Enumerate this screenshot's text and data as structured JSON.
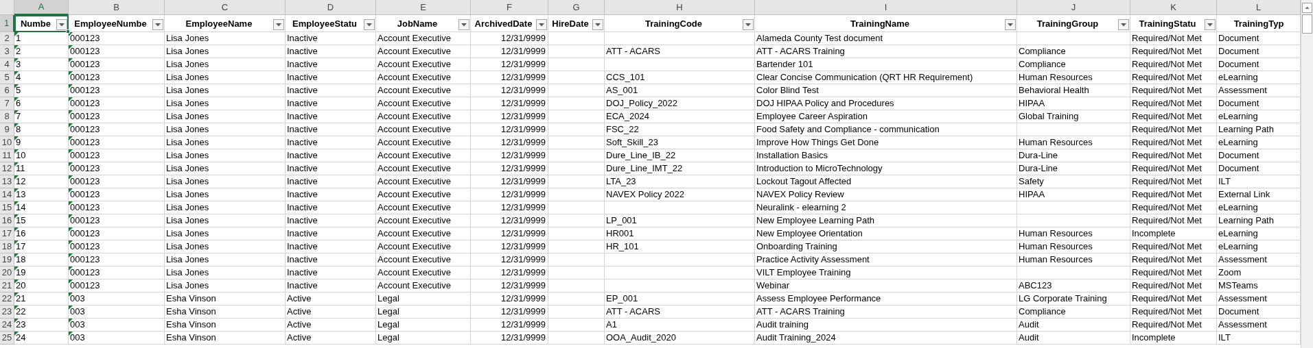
{
  "header_row_number": "1",
  "columns": [
    {
      "letter": "A",
      "header": "Numbe",
      "kind": "text",
      "selected": true,
      "filter_button": true,
      "number_as_text": true
    },
    {
      "letter": "B",
      "header": "EmployeeNumbe",
      "kind": "text",
      "selected": false,
      "filter_button": true,
      "number_as_text": true
    },
    {
      "letter": "C",
      "header": "EmployeeName",
      "kind": "text",
      "selected": false,
      "filter_button": true,
      "number_as_text": false
    },
    {
      "letter": "D",
      "header": "EmployeeStatu",
      "kind": "text",
      "selected": false,
      "filter_button": true,
      "number_as_text": false
    },
    {
      "letter": "E",
      "header": "JobName",
      "kind": "text",
      "selected": false,
      "filter_button": true,
      "number_as_text": false
    },
    {
      "letter": "F",
      "header": "ArchivedDate",
      "kind": "date",
      "selected": false,
      "filter_button": true,
      "number_as_text": false
    },
    {
      "letter": "G",
      "header": "HireDate",
      "selected": false,
      "filter_button": true,
      "number_as_text": false
    },
    {
      "letter": "H",
      "header": "TrainingCode",
      "kind": "text",
      "selected": false,
      "filter_button": true,
      "number_as_text": false
    },
    {
      "letter": "I",
      "header": "TrainingName",
      "kind": "text",
      "selected": false,
      "filter_button": true,
      "number_as_text": false
    },
    {
      "letter": "J",
      "header": "TrainingGroup",
      "kind": "text",
      "selected": false,
      "filter_button": true,
      "number_as_text": false
    },
    {
      "letter": "K",
      "header": "TrainingStatu",
      "kind": "text",
      "selected": false,
      "filter_button": true,
      "number_as_text": false
    },
    {
      "letter": "L",
      "header": "TrainingTyp",
      "kind": "text",
      "selected": false,
      "filter_button": false,
      "number_as_text": false
    }
  ],
  "rows": [
    {
      "row_number": "2",
      "cells": [
        "1",
        "000123",
        "Lisa Jones",
        "Inactive",
        "Account Executive",
        "12/31/9999",
        null,
        null,
        "Alameda County Test document",
        null,
        "Required/Not Met",
        "Document"
      ]
    },
    {
      "row_number": "3",
      "cells": [
        "2",
        "000123",
        "Lisa Jones",
        "Inactive",
        "Account Executive",
        "12/31/9999",
        null,
        "ATT - ACARS",
        "ATT - ACARS Training",
        "Compliance",
        "Required/Not Met",
        "Document"
      ]
    },
    {
      "row_number": "4",
      "cells": [
        "3",
        "000123",
        "Lisa Jones",
        "Inactive",
        "Account Executive",
        "12/31/9999",
        null,
        null,
        "Bartender 101",
        "Compliance",
        "Required/Not Met",
        "Document"
      ]
    },
    {
      "row_number": "5",
      "cells": [
        "4",
        "000123",
        "Lisa Jones",
        "Inactive",
        "Account Executive",
        "12/31/9999",
        null,
        "CCS_101",
        "Clear Concise Communication (QRT HR Requirement)",
        "Human Resources",
        "Required/Not Met",
        "eLearning"
      ]
    },
    {
      "row_number": "6",
      "cells": [
        "5",
        "000123",
        "Lisa Jones",
        "Inactive",
        "Account Executive",
        "12/31/9999",
        null,
        "AS_001",
        "Color Blind Test",
        "Behavioral Health",
        "Required/Not Met",
        "Assessment"
      ]
    },
    {
      "row_number": "7",
      "cells": [
        "6",
        "000123",
        "Lisa Jones",
        "Inactive",
        "Account Executive",
        "12/31/9999",
        null,
        "DOJ_Policy_2022",
        "DOJ HIPAA Policy and Procedures",
        "HIPAA",
        "Required/Not Met",
        "Document"
      ]
    },
    {
      "row_number": "8",
      "cells": [
        "7",
        "000123",
        "Lisa Jones",
        "Inactive",
        "Account Executive",
        "12/31/9999",
        null,
        "ECA_2024",
        "Employee Career Aspiration",
        "Global Training",
        "Required/Not Met",
        "eLearning"
      ]
    },
    {
      "row_number": "9",
      "cells": [
        "8",
        "000123",
        "Lisa Jones",
        "Inactive",
        "Account Executive",
        "12/31/9999",
        null,
        "FSC_22",
        "Food Safety and Compliance - communication",
        null,
        "Required/Not Met",
        "Learning Path"
      ]
    },
    {
      "row_number": "10",
      "cells": [
        "9",
        "000123",
        "Lisa Jones",
        "Inactive",
        "Account Executive",
        "12/31/9999",
        null,
        "Soft_Skill_23",
        "Improve How Things Get Done",
        "Human Resources",
        "Required/Not Met",
        "eLearning"
      ]
    },
    {
      "row_number": "11",
      "cells": [
        "10",
        "000123",
        "Lisa Jones",
        "Inactive",
        "Account Executive",
        "12/31/9999",
        null,
        "Dure_Line_IB_22",
        "Installation Basics",
        "Dura-Line",
        "Required/Not Met",
        "Document"
      ]
    },
    {
      "row_number": "12",
      "cells": [
        "11",
        "000123",
        "Lisa Jones",
        "Inactive",
        "Account Executive",
        "12/31/9999",
        null,
        "Dure_Line_IMT_22",
        "Introduction to MicroTechnology",
        "Dura-Line",
        "Required/Not Met",
        "Document"
      ]
    },
    {
      "row_number": "13",
      "cells": [
        "12",
        "000123",
        "Lisa Jones",
        "Inactive",
        "Account Executive",
        "12/31/9999",
        null,
        "LTA_23",
        "Lockout Tagout Affected",
        "Safety",
        "Required/Not Met",
        "ILT"
      ]
    },
    {
      "row_number": "14",
      "cells": [
        "13",
        "000123",
        "Lisa Jones",
        "Inactive",
        "Account Executive",
        "12/31/9999",
        null,
        "NAVEX Policy 2022",
        "NAVEX Policy Review",
        "HIPAA",
        "Required/Not Met",
        "External Link"
      ]
    },
    {
      "row_number": "15",
      "cells": [
        "14",
        "000123",
        "Lisa Jones",
        "Inactive",
        "Account Executive",
        "12/31/9999",
        null,
        null,
        "Neuralink - elearning 2",
        null,
        "Required/Not Met",
        "eLearning"
      ]
    },
    {
      "row_number": "16",
      "cells": [
        "15",
        "000123",
        "Lisa Jones",
        "Inactive",
        "Account Executive",
        "12/31/9999",
        null,
        "LP_001",
        "New Employee Learning Path",
        null,
        "Required/Not Met",
        "Learning Path"
      ]
    },
    {
      "row_number": "17",
      "cells": [
        "16",
        "000123",
        "Lisa Jones",
        "Inactive",
        "Account Executive",
        "12/31/9999",
        null,
        "HR001",
        "New Employee Orientation",
        "Human Resources",
        "Incomplete",
        "eLearning"
      ]
    },
    {
      "row_number": "18",
      "cells": [
        "17",
        "000123",
        "Lisa Jones",
        "Inactive",
        "Account Executive",
        "12/31/9999",
        null,
        "HR_101",
        "Onboarding Training",
        "Human Resources",
        "Required/Not Met",
        "eLearning"
      ]
    },
    {
      "row_number": "19",
      "cells": [
        "18",
        "000123",
        "Lisa Jones",
        "Inactive",
        "Account Executive",
        "12/31/9999",
        null,
        null,
        "Practice Activity Assessment",
        "Human Resources",
        "Required/Not Met",
        "Assessment"
      ]
    },
    {
      "row_number": "20",
      "cells": [
        "19",
        "000123",
        "Lisa Jones",
        "Inactive",
        "Account Executive",
        "12/31/9999",
        null,
        null,
        "VILT Employee Training",
        null,
        "Required/Not Met",
        "Zoom"
      ]
    },
    {
      "row_number": "21",
      "cells": [
        "20",
        "000123",
        "Lisa Jones",
        "Inactive",
        "Account Executive",
        "12/31/9999",
        null,
        null,
        "Webinar",
        "ABC123",
        "Required/Not Met",
        "MSTeams"
      ]
    },
    {
      "row_number": "22",
      "cells": [
        "21",
        "003",
        "Esha Vinson",
        "Active",
        "Legal",
        "12/31/9999",
        null,
        "EP_001",
        "Assess Employee Performance",
        "LG Corporate Training",
        "Required/Not Met",
        "Assessment"
      ]
    },
    {
      "row_number": "23",
      "cells": [
        "22",
        "003",
        "Esha Vinson",
        "Active",
        "Legal",
        "12/31/9999",
        null,
        "ATT - ACARS",
        "ATT - ACARS Training",
        "Compliance",
        "Required/Not Met",
        "Document"
      ]
    },
    {
      "row_number": "24",
      "cells": [
        "23",
        "003",
        "Esha Vinson",
        "Active",
        "Legal",
        "12/31/9999",
        null,
        "A1",
        "Audit training",
        "Audit",
        "Required/Not Met",
        "Assessment"
      ]
    },
    {
      "row_number": "25",
      "cells": [
        "24",
        "003",
        "Esha Vinson",
        "Active",
        "Legal",
        "12/31/9999",
        null,
        "OOA_Audit_2020",
        "Audit Training_2024",
        "Audit",
        "Incomplete",
        "ILT"
      ]
    }
  ]
}
